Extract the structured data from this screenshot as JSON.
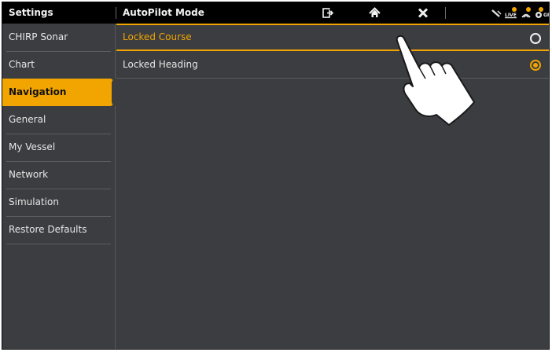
{
  "topbar": {
    "settings_label": "Settings",
    "title": "AutoPilot Mode",
    "icons": [
      "exit-icon",
      "home-icon",
      "close-icon",
      "satellite-icon",
      "live-icon",
      "sonar-icon",
      "gps-icon"
    ],
    "status_live_text": "LIVE",
    "status_gps_text": "GP"
  },
  "sidebar": {
    "items": [
      {
        "label": "CHIRP Sonar"
      },
      {
        "label": "Chart"
      },
      {
        "label": "Navigation",
        "active": true
      },
      {
        "label": "General"
      },
      {
        "label": "My Vessel"
      },
      {
        "label": "Network"
      },
      {
        "label": "Simulation"
      },
      {
        "label": "Restore Defaults"
      }
    ]
  },
  "main": {
    "options": [
      {
        "label": "Locked Course",
        "highlighted": true,
        "checked": false
      },
      {
        "label": "Locked Heading",
        "highlighted": false,
        "checked": true
      }
    ]
  },
  "colors": {
    "accent": "#f2a500",
    "background": "#3b3d40",
    "topbar": "#000000"
  }
}
